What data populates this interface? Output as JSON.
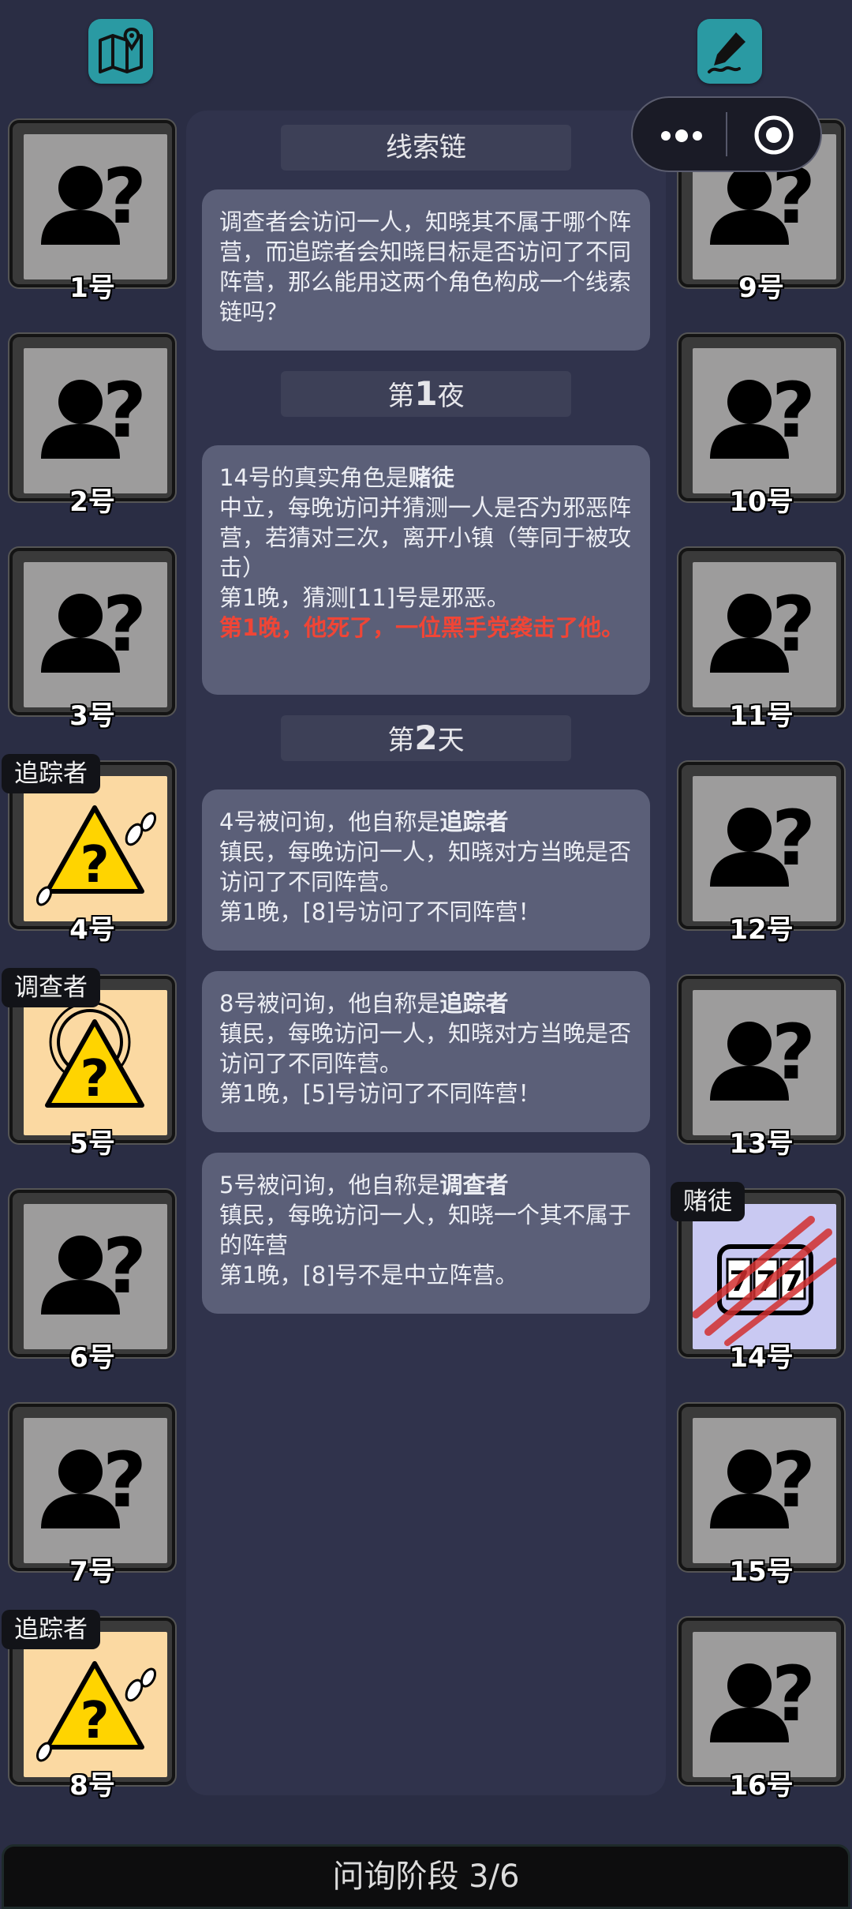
{
  "top": {
    "map_icon": "map-pin-icon",
    "edit_icon": "pen-signature-icon"
  },
  "capsule": {
    "more_icon": "more-dots-icon",
    "close_icon": "target-circle-icon"
  },
  "sections": {
    "clue_chain": "线索链",
    "night1_prefix": "第",
    "night1_num": "1",
    "night1_suffix": "夜",
    "day2_prefix": "第",
    "day2_num": "2",
    "day2_suffix": "天"
  },
  "messages": {
    "intro": "调查者会访问一人，知晓其不属于哪个阵营，而追踪者会知晓目标是否访问了不同阵营，那么能用这两个角色构成一个线索链吗？",
    "night1": {
      "line1_prefix": "14号的真实角色是",
      "line1_role": "赌徒",
      "line2": "中立，每晚访问并猜测一人是否为邪恶阵营，若猜对三次，离开小镇（等同于被攻击）",
      "line3": "第1晚，猜测[11]号是邪恶。",
      "line4_red": "第1晚，他死了，一位黑手党袭击了他。"
    },
    "q1": {
      "line1_prefix": "4号被问询，他自称是",
      "line1_role": "追踪者",
      "line2": "镇民，每晚访问一人，知晓对方当晚是否访问了不同阵营。",
      "line3": "第1晚，[8]号访问了不同阵营！"
    },
    "q2": {
      "line1_prefix": "8号被问询，他自称是",
      "line1_role": "追踪者",
      "line2": "镇民，每晚访问一人，知晓对方当晚是否访问了不同阵营。",
      "line3": "第1晚，[5]号访问了不同阵营！"
    },
    "q3": {
      "line1_prefix": "5号被问询，他自称是",
      "line1_role": "调查者",
      "line2": "镇民，每晚访问一人，知晓一个其不属于的阵营",
      "line3": "第1晚，[8]号不是中立阵营。"
    }
  },
  "players_left": [
    {
      "num": "1号",
      "tag": "",
      "icon": "unknown-person-icon"
    },
    {
      "num": "2号",
      "tag": "",
      "icon": "unknown-person-icon"
    },
    {
      "num": "3号",
      "tag": "",
      "icon": "unknown-person-icon"
    },
    {
      "num": "4号",
      "tag": "追踪者",
      "icon": "tracker-warning-icon"
    },
    {
      "num": "5号",
      "tag": "调查者",
      "icon": "investigator-warning-icon"
    },
    {
      "num": "6号",
      "tag": "",
      "icon": "unknown-person-icon"
    },
    {
      "num": "7号",
      "tag": "",
      "icon": "unknown-person-icon"
    },
    {
      "num": "8号",
      "tag": "追踪者",
      "icon": "tracker-warning-icon"
    }
  ],
  "players_right": [
    {
      "num": "9号",
      "tag": "",
      "icon": "unknown-person-icon"
    },
    {
      "num": "10号",
      "tag": "",
      "icon": "unknown-person-icon"
    },
    {
      "num": "11号",
      "tag": "",
      "icon": "unknown-person-icon"
    },
    {
      "num": "12号",
      "tag": "",
      "icon": "unknown-person-icon"
    },
    {
      "num": "13号",
      "tag": "",
      "icon": "unknown-person-icon"
    },
    {
      "num": "14号",
      "tag": "赌徒",
      "icon": "slot-machine-slashed-icon"
    },
    {
      "num": "15号",
      "tag": "",
      "icon": "unknown-person-icon"
    },
    {
      "num": "16号",
      "tag": "",
      "icon": "unknown-person-icon"
    }
  ],
  "phase": "问询阶段 3/6",
  "colors": {
    "background": "#2a2d44",
    "panel": "#30334c",
    "bubble": "#5b5f78",
    "accent": "#2a9aa3",
    "danger": "#f04536"
  }
}
